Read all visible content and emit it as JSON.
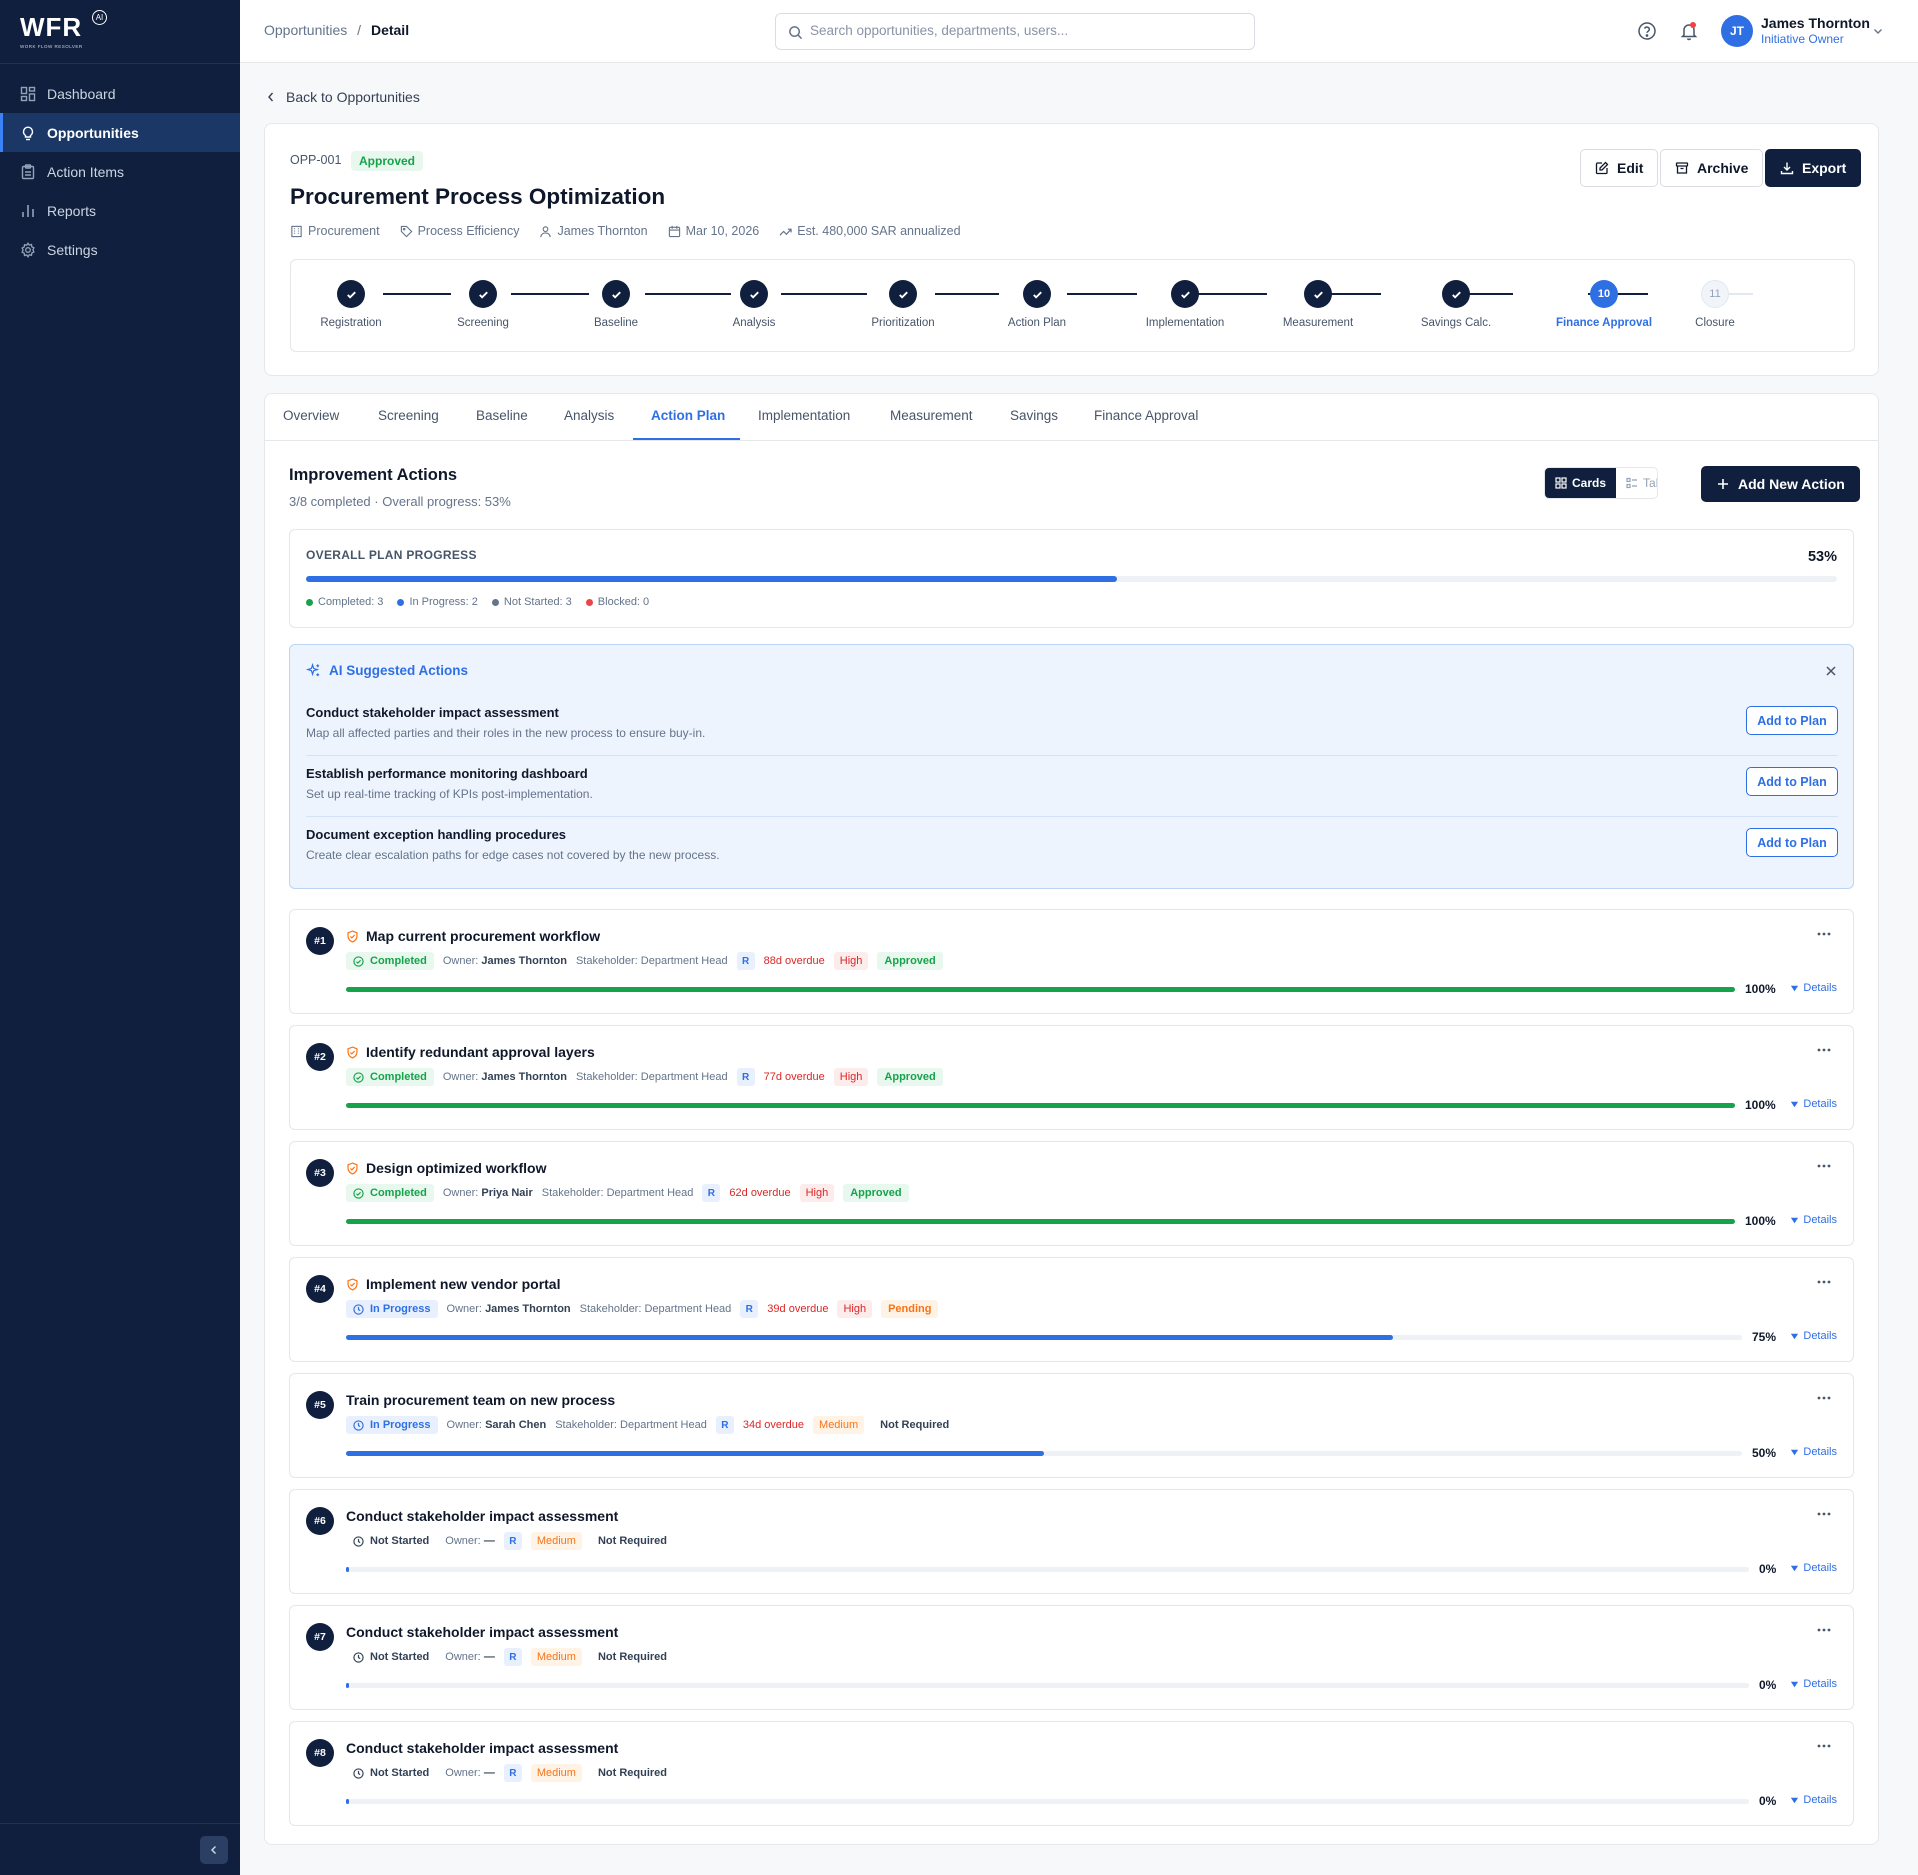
{
  "sidebar": {
    "logo_text": "WFR",
    "logo_badge": "AI",
    "logo_tagline": "WORK FLOW RESOLVER",
    "items": [
      {
        "label": "Dashboard",
        "icon": "grid-icon",
        "active": false
      },
      {
        "label": "Opportunities",
        "icon": "lightbulb-icon",
        "active": true
      },
      {
        "label": "Action Items",
        "icon": "clipboard-icon",
        "active": false
      },
      {
        "label": "Reports",
        "icon": "bar-chart-icon",
        "active": false
      },
      {
        "label": "Settings",
        "icon": "gear-icon",
        "active": false
      }
    ]
  },
  "topbar": {
    "breadcrumb_parent": "Opportunities",
    "breadcrumb_sep": "/",
    "breadcrumb_current": "Detail",
    "search_placeholder": "Search opportunities, departments, users...",
    "user": {
      "initials": "JT",
      "name": "James Thornton",
      "role": "Initiative Owner"
    }
  },
  "back_label": "Back to Opportunities",
  "opportunity": {
    "id": "OPP-001",
    "status": "Approved",
    "title": "Procurement Process Optimization",
    "meta": {
      "department": "Procurement",
      "category": "Process Efficiency",
      "owner": "James Thornton",
      "date": "Mar 10, 2026",
      "savings": "Est. 480,000 SAR annualized"
    },
    "buttons": {
      "edit": "Edit",
      "archive": "Archive",
      "export": "Export"
    }
  },
  "stages": [
    {
      "label": "Registration",
      "state": "done",
      "number": "1"
    },
    {
      "label": "Screening",
      "state": "done",
      "number": "2"
    },
    {
      "label": "Baseline",
      "state": "done",
      "number": "3"
    },
    {
      "label": "Analysis",
      "state": "done",
      "number": "4"
    },
    {
      "label": "Prioritization",
      "state": "done",
      "number": "5"
    },
    {
      "label": "Action Plan",
      "state": "done",
      "number": "6"
    },
    {
      "label": "Implementation",
      "state": "done",
      "number": "7"
    },
    {
      "label": "Measurement",
      "state": "done",
      "number": "8"
    },
    {
      "label": "Savings Calc.",
      "state": "done",
      "number": "9"
    },
    {
      "label": "Finance Approval",
      "state": "current",
      "number": "10"
    },
    {
      "label": "Closure",
      "state": "todo",
      "number": "11"
    }
  ],
  "tabs": [
    {
      "label": "Overview",
      "active": false
    },
    {
      "label": "Screening",
      "active": false
    },
    {
      "label": "Baseline",
      "active": false
    },
    {
      "label": "Analysis",
      "active": false
    },
    {
      "label": "Action Plan",
      "active": true
    },
    {
      "label": "Implementation",
      "active": false
    },
    {
      "label": "Measurement",
      "active": false
    },
    {
      "label": "Savings",
      "active": false
    },
    {
      "label": "Finance Approval",
      "active": false
    }
  ],
  "plan": {
    "title": "Improvement Actions",
    "subtitle": "3/8 completed · Overall progress: 53%",
    "view_toggle": {
      "cards": "Cards",
      "table": "Table",
      "selected": "Cards"
    },
    "add_button": "Add New Action",
    "overall": {
      "label": "OVERALL PLAN PROGRESS",
      "percent_text": "53%",
      "percent": 53,
      "legend": [
        {
          "label": "Completed: 3",
          "color": "#16a34a"
        },
        {
          "label": "In Progress: 2",
          "color": "#2f6fe4"
        },
        {
          "label": "Not Started: 3",
          "color": "#64748b"
        },
        {
          "label": "Blocked: 0",
          "color": "#ef4444"
        }
      ]
    }
  },
  "ai_suggestions": {
    "title": "AI Suggested Actions",
    "add_label": "Add to Plan",
    "items": [
      {
        "title": "Conduct stakeholder impact assessment",
        "desc": "Map all affected parties and their roles in the new process to ensure buy-in."
      },
      {
        "title": "Establish performance monitoring dashboard",
        "desc": "Set up real-time tracking of KPIs post-implementation."
      },
      {
        "title": "Document exception handling procedures",
        "desc": "Create clear escalation paths for edge cases not covered by the new process."
      }
    ]
  },
  "labels": {
    "owner": "Owner:",
    "stakeholder_prefix": "Stakeholder:",
    "details": "Details",
    "raci": "R"
  },
  "actions": [
    {
      "num": "#1",
      "title": "Map current procurement workflow",
      "critical": true,
      "status": "Completed",
      "status_key": "completed",
      "owner": "James Thornton",
      "stakeholder": "Department Head",
      "overdue": "88d overdue",
      "priority": "High",
      "approval": "Approved",
      "approval_key": "approved",
      "progress": 100,
      "progress_text": "100%"
    },
    {
      "num": "#2",
      "title": "Identify redundant approval layers",
      "critical": true,
      "status": "Completed",
      "status_key": "completed",
      "owner": "James Thornton",
      "stakeholder": "Department Head",
      "overdue": "77d overdue",
      "priority": "High",
      "approval": "Approved",
      "approval_key": "approved",
      "progress": 100,
      "progress_text": "100%"
    },
    {
      "num": "#3",
      "title": "Design optimized workflow",
      "critical": true,
      "status": "Completed",
      "status_key": "completed",
      "owner": "Priya Nair",
      "stakeholder": "Department Head",
      "overdue": "62d overdue",
      "priority": "High",
      "approval": "Approved",
      "approval_key": "approved",
      "progress": 100,
      "progress_text": "100%"
    },
    {
      "num": "#4",
      "title": "Implement new vendor portal",
      "critical": true,
      "status": "In Progress",
      "status_key": "progress",
      "owner": "James Thornton",
      "stakeholder": "Department Head",
      "overdue": "39d overdue",
      "priority": "High",
      "approval": "Pending",
      "approval_key": "pending",
      "progress": 75,
      "progress_text": "75%"
    },
    {
      "num": "#5",
      "title": "Train procurement team on new process",
      "critical": false,
      "status": "In Progress",
      "status_key": "progress",
      "owner": "Sarah Chen",
      "stakeholder": "Department Head",
      "overdue": "34d overdue",
      "priority": "Medium",
      "approval": "Not Required",
      "approval_key": "notreq",
      "progress": 50,
      "progress_text": "50%"
    },
    {
      "num": "#6",
      "title": "Conduct stakeholder impact assessment",
      "critical": false,
      "status": "Not Started",
      "status_key": "notstarted",
      "owner": "—",
      "stakeholder": "",
      "overdue": "",
      "priority": "Medium",
      "approval": "Not Required",
      "approval_key": "notreq",
      "progress": 0,
      "progress_text": "0%"
    },
    {
      "num": "#7",
      "title": "Conduct stakeholder impact assessment",
      "critical": false,
      "status": "Not Started",
      "status_key": "notstarted",
      "owner": "—",
      "stakeholder": "",
      "overdue": "",
      "priority": "Medium",
      "approval": "Not Required",
      "approval_key": "notreq",
      "progress": 0,
      "progress_text": "0%"
    },
    {
      "num": "#8",
      "title": "Conduct stakeholder impact assessment",
      "critical": false,
      "status": "Not Started",
      "status_key": "notstarted",
      "owner": "—",
      "stakeholder": "",
      "overdue": "",
      "priority": "Medium",
      "approval": "Not Required",
      "approval_key": "notreq",
      "progress": 0,
      "progress_text": "0%"
    }
  ],
  "colors": {
    "navy": "#0f1f3d",
    "accent": "#2f6fe4",
    "success": "#16a34a",
    "danger": "#dc2626",
    "warning": "#f97316"
  }
}
